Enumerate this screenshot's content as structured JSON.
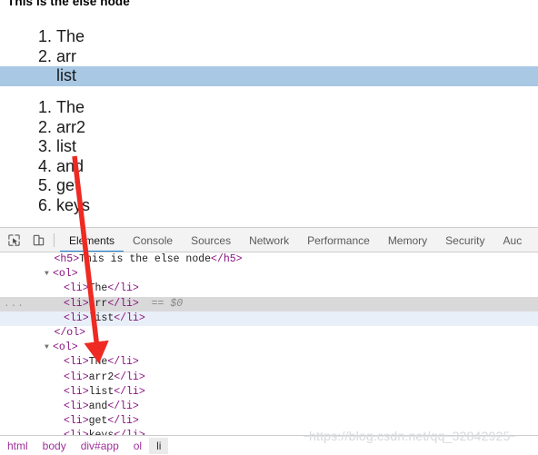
{
  "page": {
    "heading": "This is the else node",
    "list_one": [
      {
        "text": "The",
        "selected": false
      },
      {
        "text": "arr",
        "selected": false
      },
      {
        "text": "list",
        "selected": true
      }
    ],
    "list_two": [
      {
        "text": "The"
      },
      {
        "text": "arr2"
      },
      {
        "text": "list"
      },
      {
        "text": "and"
      },
      {
        "text": "get"
      },
      {
        "text": "keys"
      }
    ]
  },
  "devtools": {
    "toolbar": {
      "inspect_icon": "inspect-element-icon",
      "device_icon": "device-toolbar-icon"
    },
    "tabs": [
      {
        "label": "Elements",
        "active": true
      },
      {
        "label": "Console",
        "active": false
      },
      {
        "label": "Sources",
        "active": false
      },
      {
        "label": "Network",
        "active": false
      },
      {
        "label": "Performance",
        "active": false
      },
      {
        "label": "Memory",
        "active": false
      },
      {
        "label": "Security",
        "active": false
      },
      {
        "label": "Auc",
        "active": false
      }
    ],
    "dom_rows": [
      {
        "indent": 3,
        "triangle": "",
        "html": "<span class=\"tag\">&lt;h5&gt;</span><span class=\"txt\">This is the else node</span><span class=\"tag\">&lt;/h5&gt;</span>",
        "state": "",
        "gutter": ""
      },
      {
        "indent": 2,
        "triangle": "down",
        "html": "<span class=\"tag\">&lt;ol&gt;</span>",
        "state": "",
        "gutter": ""
      },
      {
        "indent": 4,
        "triangle": "",
        "html": "<span class=\"tag\">&lt;li&gt;</span><span class=\"txt\">The</span><span class=\"tag\">&lt;/li&gt;</span>",
        "state": "",
        "gutter": ""
      },
      {
        "indent": 4,
        "triangle": "",
        "html": "<span class=\"tag\">&lt;li&gt;</span><span class=\"txt\">arr</span><span class=\"tag\">&lt;/li&gt;</span><span class=\"dollar\">  == $0</span>",
        "state": "hovered",
        "gutter": "..."
      },
      {
        "indent": 4,
        "triangle": "",
        "html": "<span class=\"tag\">&lt;li&gt;</span><span class=\"txt\">list</span><span class=\"tag\">&lt;/li&gt;</span>",
        "state": "selected",
        "gutter": ""
      },
      {
        "indent": 3,
        "triangle": "",
        "html": "<span class=\"tag\">&lt;/ol&gt;</span>",
        "state": "",
        "gutter": ""
      },
      {
        "indent": 2,
        "triangle": "down",
        "html": "<span class=\"tag\">&lt;ol&gt;</span>",
        "state": "",
        "gutter": ""
      },
      {
        "indent": 4,
        "triangle": "",
        "html": "<span class=\"tag\">&lt;li&gt;</span><span class=\"txt\">The</span><span class=\"tag\">&lt;/li&gt;</span>",
        "state": "",
        "gutter": ""
      },
      {
        "indent": 4,
        "triangle": "",
        "html": "<span class=\"tag\">&lt;li&gt;</span><span class=\"txt\">arr2</span><span class=\"tag\">&lt;/li&gt;</span>",
        "state": "",
        "gutter": ""
      },
      {
        "indent": 4,
        "triangle": "",
        "html": "<span class=\"tag\">&lt;li&gt;</span><span class=\"txt\">list</span><span class=\"tag\">&lt;/li&gt;</span>",
        "state": "",
        "gutter": ""
      },
      {
        "indent": 4,
        "triangle": "",
        "html": "<span class=\"tag\">&lt;li&gt;</span><span class=\"txt\">and</span><span class=\"tag\">&lt;/li&gt;</span>",
        "state": "",
        "gutter": ""
      },
      {
        "indent": 4,
        "triangle": "",
        "html": "<span class=\"tag\">&lt;li&gt;</span><span class=\"txt\">get</span><span class=\"tag\">&lt;/li&gt;</span>",
        "state": "",
        "gutter": ""
      },
      {
        "indent": 4,
        "triangle": "",
        "html": "<span class=\"tag\">&lt;li&gt;</span><span class=\"txt\">keys</span><span class=\"tag\">&lt;/li&gt;</span>",
        "state": "",
        "gutter": ""
      }
    ],
    "breadcrumbs": [
      {
        "label": "html",
        "active": false
      },
      {
        "label": "body",
        "active": false
      },
      {
        "label": "div#app",
        "active": false
      },
      {
        "label": "ol",
        "active": false
      },
      {
        "label": "li",
        "active": true
      }
    ]
  },
  "annotation": {
    "arrow_color": "#ee2a22"
  },
  "watermark": {
    "text": "https://blog.csdn.net/qq_32842925"
  },
  "colors": {
    "selection_blue": "#a8c8e4",
    "devtools_tab_accent": "#1a7fd4",
    "dom_selected": "#e9eff8",
    "dom_hovered": "#d9d9d9",
    "tag_purple": "#881280",
    "crumb_purple": "#a0309a"
  }
}
